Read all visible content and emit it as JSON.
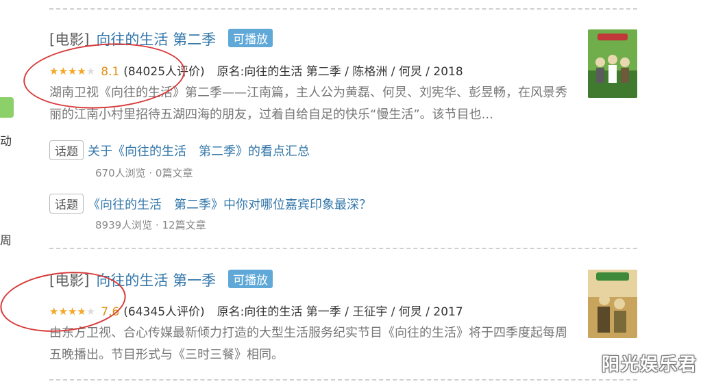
{
  "sidebar": {
    "text_1": "动",
    "text_2": "周"
  },
  "results": [
    {
      "type_tag": "[电影]",
      "title": "向往的生活 第二季",
      "playable_label": "可播放",
      "rating_fraction": 0.81,
      "score": "8.1",
      "votes": "(84025人评价)",
      "original": "原名:向往的生活 第二季 / 陈格洲 / 何炅 / 2018",
      "description": "湖南卫视《向往的生活》第二季——江南篇，主人公为黄磊、何炅、刘宪华、彭昱畅，在风景秀丽的江南小村里招待五湖四海的朋友，过着自给自足的快乐“慢生活”。该节目也...",
      "topics": [
        {
          "badge": "话题",
          "title": "关于《向往的生活　第二季》的看点汇总",
          "meta": "670人浏览 · 0篇文章"
        },
        {
          "badge": "话题",
          "title": "《向往的生活　第二季》中你对哪位嘉宾印象最深？",
          "meta": "8939人浏览 · 12篇文章"
        }
      ],
      "poster_colors": [
        "#6fae4a",
        "#e8d8b0",
        "#3f7a2f"
      ]
    },
    {
      "type_tag": "[电影]",
      "title": "向往的生活 第一季",
      "playable_label": "可播放",
      "rating_fraction": 0.76,
      "score": "7.6",
      "votes": "(64345人评价)",
      "original": "原名:向往的生活 第一季 / 王征宇 / 何炅 / 2017",
      "description": "由东方卫视、合心传媒最新倾力打造的大型生活服务纪实节目《向往的生活》将于四季度起每周五晚播出。节目形式与《三时三餐》相同。",
      "poster_colors": [
        "#c9a45c",
        "#7a6a3a",
        "#e6d3a0"
      ]
    }
  ],
  "watermark": "阳光娱乐君",
  "colors": {
    "link": "#3377aa",
    "badge_bg": "#5fa8d8",
    "star": "#f5a623",
    "circle": "#d83b3b"
  }
}
